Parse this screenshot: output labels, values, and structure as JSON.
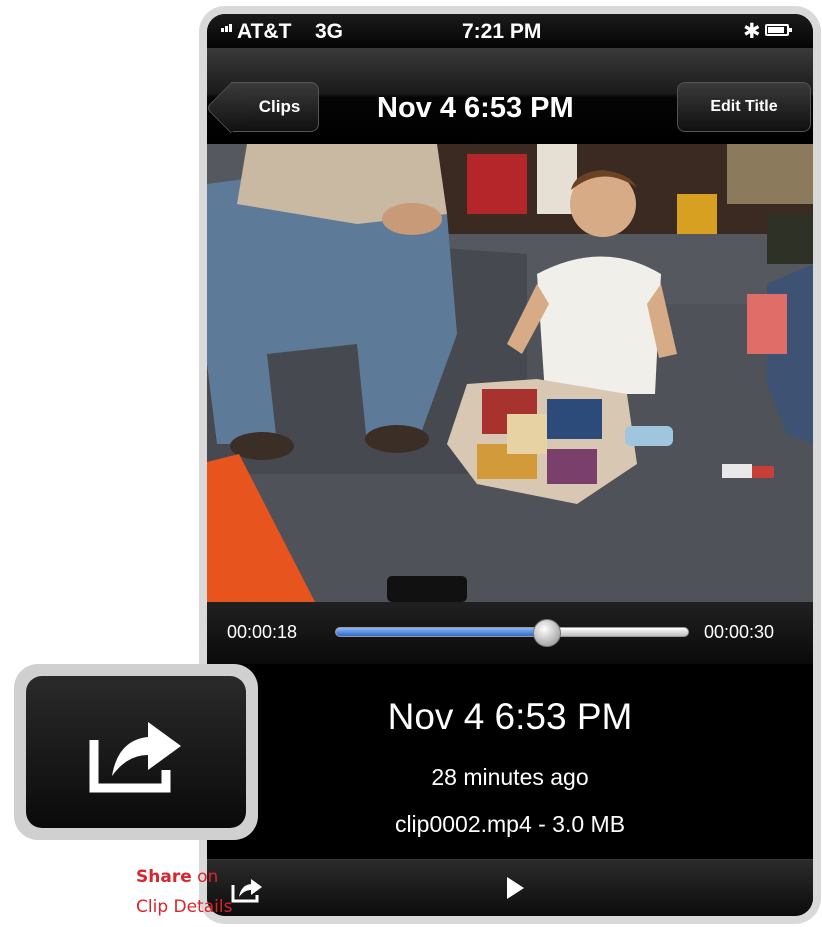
{
  "status_bar": {
    "carrier": "AT&T",
    "network": "3G",
    "time": "7:21 PM"
  },
  "nav_bar": {
    "back_label": "Clips",
    "title": "Nov 4  6:53 PM",
    "edit_label": "Edit Title"
  },
  "scrubber": {
    "current_time": "00:00:18",
    "total_time": "00:00:30",
    "progress": 0.6
  },
  "details": {
    "title": "Nov 4  6:53 PM",
    "relative_time": "28 minutes ago",
    "file_info": "clip0002.mp4  -  3.0 MB"
  },
  "toolbar": {
    "share_icon": "share-icon",
    "play_icon": "play-icon"
  },
  "callout": {
    "icon": "share-icon",
    "caption_bold": "Share",
    "caption_rest": " on",
    "caption_line2": "Clip Details"
  },
  "colors": {
    "accent": "#d9252b",
    "scrubber_fill": "#2e6ad0"
  }
}
